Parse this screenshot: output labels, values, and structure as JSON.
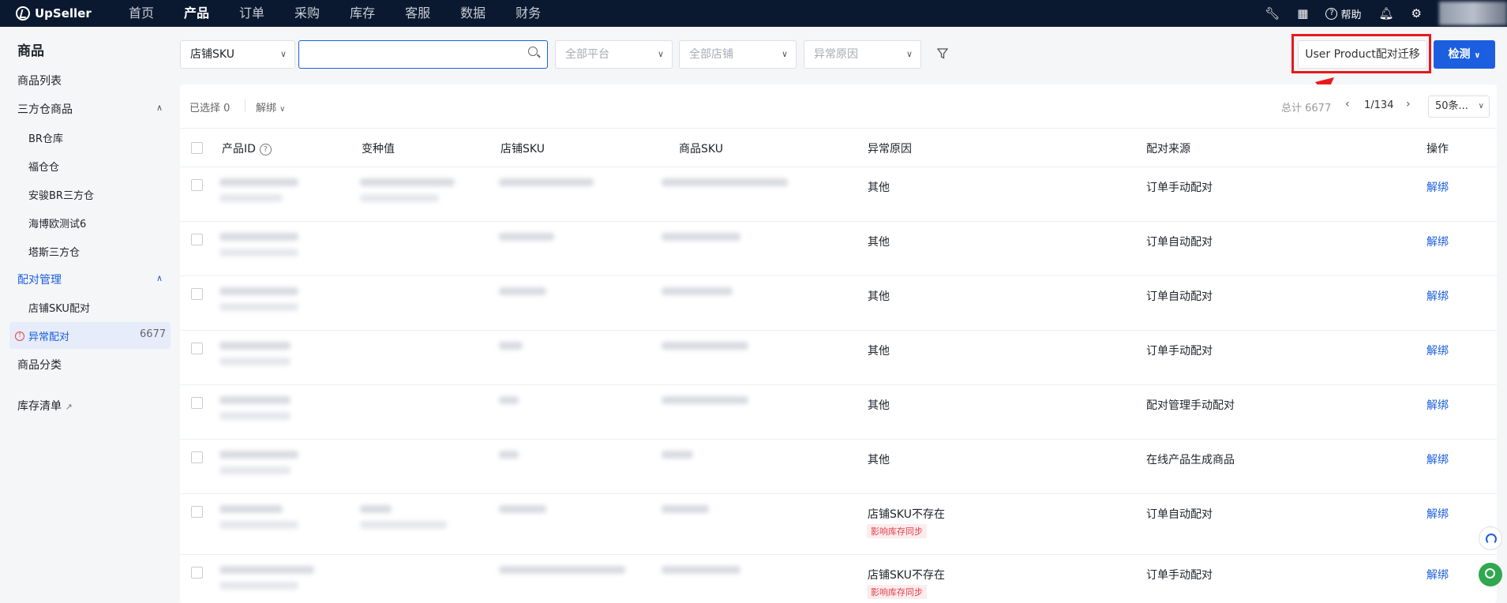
{
  "brand": {
    "name": "UpSeller"
  },
  "nav": {
    "items": [
      "首页",
      "产品",
      "订单",
      "采购",
      "库存",
      "客服",
      "数据",
      "财务"
    ],
    "active_index": 1,
    "help_label": "帮助"
  },
  "sidebar": {
    "title": "商品",
    "product_list": "商品列表",
    "third_party": "三方仓商品",
    "warehouses": [
      "BR仓库",
      "福仓仓",
      "安骏BR三方仓",
      "海博欧测试6",
      "塔斯三方仓"
    ],
    "pairing": "配对管理",
    "store_sku_pairing": "店铺SKU配对",
    "abnormal_pairing": "异常配对",
    "abnormal_count": "6677",
    "category": "商品分类",
    "inventory_list": "库存清单"
  },
  "filters": {
    "sku_type": "店铺SKU",
    "search_placeholder": "",
    "platform_placeholder": "全部平台",
    "store_placeholder": "全部店铺",
    "reason_placeholder": "异常原因"
  },
  "actions": {
    "migrate_label": "User Product配对迁移",
    "detect_label": "检测"
  },
  "table_toolbar": {
    "selected_label": "已选择",
    "selected_count": "0",
    "bulk_unbind": "解绑",
    "total_text": "总计 6677",
    "page_text": "1/134",
    "page_size": "50条..."
  },
  "table": {
    "columns": [
      "产品ID",
      "变种值",
      "店铺SKU",
      "商品SKU",
      "异常原因",
      "配对来源",
      "操作"
    ],
    "rows": [
      {
        "reason": "其他",
        "source": "订单手动配对",
        "action": "解绑",
        "tag": ""
      },
      {
        "reason": "其他",
        "source": "订单自动配对",
        "action": "解绑",
        "tag": ""
      },
      {
        "reason": "其他",
        "source": "订单自动配对",
        "action": "解绑",
        "tag": ""
      },
      {
        "reason": "其他",
        "source": "订单手动配对",
        "action": "解绑",
        "tag": ""
      },
      {
        "reason": "其他",
        "source": "配对管理手动配对",
        "action": "解绑",
        "tag": ""
      },
      {
        "reason": "其他",
        "source": "在线产品生成商品",
        "action": "解绑",
        "tag": ""
      },
      {
        "reason": "店铺SKU不存在",
        "source": "订单自动配对",
        "action": "解绑",
        "tag": "影响库存同步"
      },
      {
        "reason": "店铺SKU不存在",
        "source": "订单手动配对",
        "action": "解绑",
        "tag": "影响库存同步"
      }
    ]
  },
  "colors": {
    "nav_bg": "#0b1930",
    "primary": "#1b5ee0",
    "highlight": "#e8191c",
    "danger": "#e0434b"
  }
}
